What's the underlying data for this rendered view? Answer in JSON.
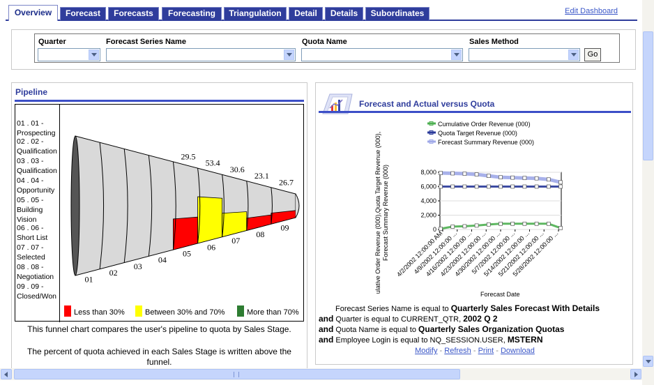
{
  "tabs": [
    {
      "label": "Overview",
      "active": true
    },
    {
      "label": "Forecast"
    },
    {
      "label": "Forecasts"
    },
    {
      "label": "Forecasting"
    },
    {
      "label": "Triangulation"
    },
    {
      "label": "Detail"
    },
    {
      "label": "Details"
    },
    {
      "label": "Subordinates"
    }
  ],
  "edit_dashboard": "Edit Dashboard",
  "prompts": {
    "quarter_label": "Quarter",
    "series_label": "Forecast Series Name",
    "quota_label": "Quota Name",
    "method_label": "Sales Method",
    "go_label": "Go"
  },
  "pipeline": {
    "title": "Pipeline",
    "stages": [
      "01 . 01 -\nProspecting",
      "02 . 02 -\nQualification",
      "03 . 03 -\nQualification",
      "04 . 04 -\nOpportunity",
      "05 . 05 -\nBuilding\nVision",
      "06 . 06 -\nShort List",
      "07 . 07 -\nSelected",
      "08 . 08 -\nNegotiation",
      "09 . 09 -\nClosed/Won"
    ],
    "stage_numbers": [
      "01",
      "02",
      "03",
      "04",
      "05",
      "06",
      "07",
      "08",
      "09"
    ],
    "value_labels": [
      {
        "stage": "05",
        "value": "29.5"
      },
      {
        "stage": "06",
        "value": "53.4"
      },
      {
        "stage": "07",
        "value": "30.6"
      },
      {
        "stage": "08",
        "value": "23.1"
      },
      {
        "stage": "09",
        "value": "26.7"
      }
    ],
    "fill_colors": {
      "low": "#ff0000",
      "mid": "#ffff00",
      "high": "#2e7d32"
    },
    "legend": [
      "Less than 30%",
      "Between 30% and 70%",
      "More than 70%"
    ],
    "description1": "This funnel chart compares the user's pipeline to quota by Sales Stage.",
    "description2": "The percent of quota achieved in each Sales Stage is written above the funnel."
  },
  "forecast": {
    "title": "Forecast and Actual versus Quota",
    "filters": [
      {
        "key": "",
        "subject": "Forecast Series Name is equal to ",
        "value": "Quarterly Sales Forecast With Details"
      },
      {
        "key": "and",
        "subject": "Quarter is equal to CURRENT_QTR, ",
        "value": "2002 Q 2"
      },
      {
        "key": "and",
        "subject": "Quota Name is equal to ",
        "value": "Quarterly Sales Organization Quotas"
      },
      {
        "key": "and",
        "subject": "Employee Login is equal to NQ_SESSION.USER, ",
        "value": "MSTERN"
      }
    ],
    "links": [
      "Modify",
      "Refresh",
      "Print",
      "Download"
    ],
    "link_separator": " - "
  },
  "chart_data": {
    "type": "line",
    "xlabel": "Forecast Date",
    "ylabel": "ulative Order Revenue (000),Quota Target Revenue (000),Forecast Summary Revenue (000)",
    "ylim": [
      0,
      8000
    ],
    "yticks": [
      "0",
      "2,000",
      "4,000",
      "6,000",
      "8,000"
    ],
    "categories": [
      "4/2/2002 12:00:00 AM",
      "4/9/2002 12:00:00 ...",
      "4/16/2002 12:00:00 ...",
      "4/23/2002 12:00:00 ...",
      "4/30/2002 12:00:00 ...",
      "5/7/2002 12:00:00 ...",
      "5/14/2002 12:00:00 ...",
      "5/21/2002 12:00:00 ...",
      "5/28/2002 12:00:00 ..."
    ],
    "series": [
      {
        "name": "Cumulative Order Revenue (000)",
        "color": "#4caf50",
        "values": [
          100,
          400,
          450,
          550,
          700,
          800,
          800,
          800,
          800,
          800,
          200
        ]
      },
      {
        "name": "Quota Target Revenue (000)",
        "color": "#2a3a9a",
        "values": [
          6000,
          6000,
          6000,
          6000,
          6000,
          6000,
          6000,
          6000,
          6000,
          6000,
          6000
        ]
      },
      {
        "name": "Forecast Summary Revenue (000)",
        "color": "#9fa8e8",
        "values": [
          7900,
          7850,
          7800,
          7700,
          7500,
          7300,
          7250,
          7200,
          7150,
          7000,
          6600
        ]
      }
    ],
    "legend_position": "top"
  }
}
